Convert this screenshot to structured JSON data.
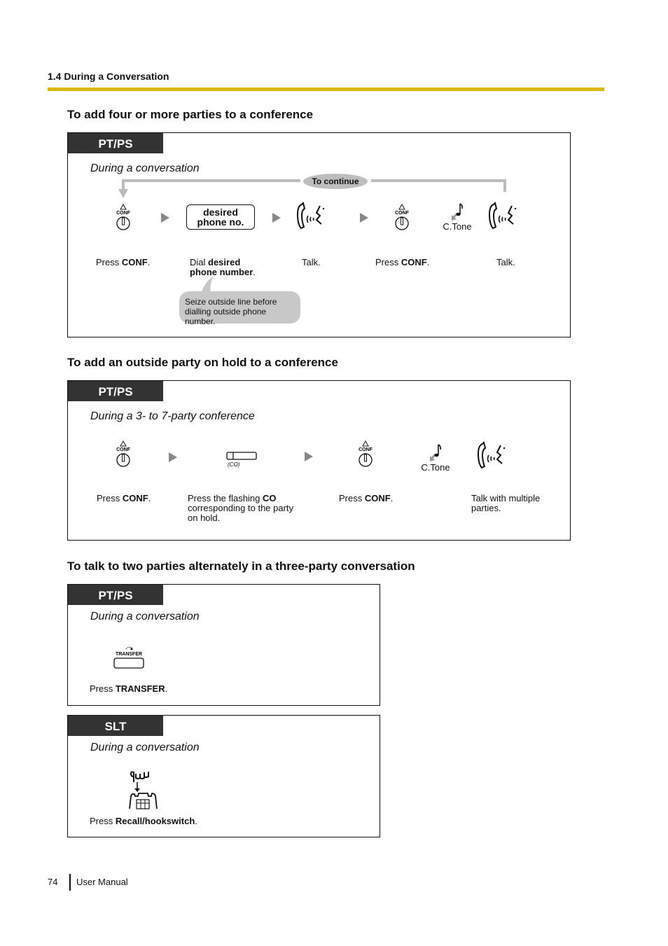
{
  "page": {
    "section_header": "1.4 During a Conversation",
    "accent_color": "#dcb800",
    "footer": {
      "page_number": "74",
      "title": "User Manual"
    }
  },
  "sections": [
    {
      "heading": "To add four or more parties to a conference",
      "tag": "PT/PS",
      "condition": "During a conversation",
      "loop_label": "To continue",
      "steps": [
        {
          "icon": "conf-button-icon",
          "icon_text": "CONF",
          "caption_pre": "Press ",
          "caption_bold": "CONF",
          "caption_post": "."
        },
        {
          "icon": "dial-box",
          "box_line1": "desired",
          "box_line2": "phone no.",
          "caption_pre": "Dial ",
          "caption_bold": "desired phone number",
          "caption_post": "."
        },
        {
          "icon": "talk-icon",
          "caption_pre": "Talk.",
          "caption_bold": "",
          "caption_post": ""
        },
        {
          "icon": "conf-button-icon",
          "icon_text": "CONF",
          "caption_pre": "Press ",
          "caption_bold": "CONF",
          "caption_post": "."
        },
        {
          "icon": "confirmation-tone-icon",
          "icon_text": "C.Tone"
        },
        {
          "icon": "talk-icon",
          "caption_pre": "Talk.",
          "caption_bold": "",
          "caption_post": ""
        }
      ],
      "note": "Seize outside line before dialling outside phone number."
    },
    {
      "heading": "To add an outside party on hold to a conference",
      "tag": "PT/PS",
      "condition": "During a 3- to 7-party conference",
      "steps": [
        {
          "icon": "conf-button-icon",
          "icon_text": "CONF",
          "caption_pre": "Press ",
          "caption_bold": "CONF",
          "caption_post": "."
        },
        {
          "icon": "co-button-icon",
          "icon_text": "(CO)",
          "caption_pre": "Press the flashing ",
          "caption_bold": "CO",
          "caption_post": " corresponding to the party on hold."
        },
        {
          "icon": "conf-button-icon",
          "icon_text": "CONF",
          "caption_pre": "Press ",
          "caption_bold": "CONF",
          "caption_post": "."
        },
        {
          "icon": "confirmation-tone-icon",
          "icon_text": "C.Tone"
        },
        {
          "icon": "talk-icon",
          "caption_pre": "Talk with multiple parties.",
          "caption_bold": "",
          "caption_post": ""
        }
      ]
    },
    {
      "heading": "To talk to two parties alternately in a three-party conversation",
      "tag": "PT/PS",
      "condition": "During a conversation",
      "steps": [
        {
          "icon": "transfer-button-icon",
          "icon_text": "TRANSFER",
          "caption_pre": "Press ",
          "caption_bold": "TRANSFER",
          "caption_post": "."
        }
      ]
    },
    {
      "tag": "SLT",
      "condition": "During a conversation",
      "steps": [
        {
          "icon": "hookswitch-icon",
          "caption_pre": "Press ",
          "caption_bold": "Recall/hookswitch",
          "caption_post": "."
        }
      ]
    }
  ]
}
